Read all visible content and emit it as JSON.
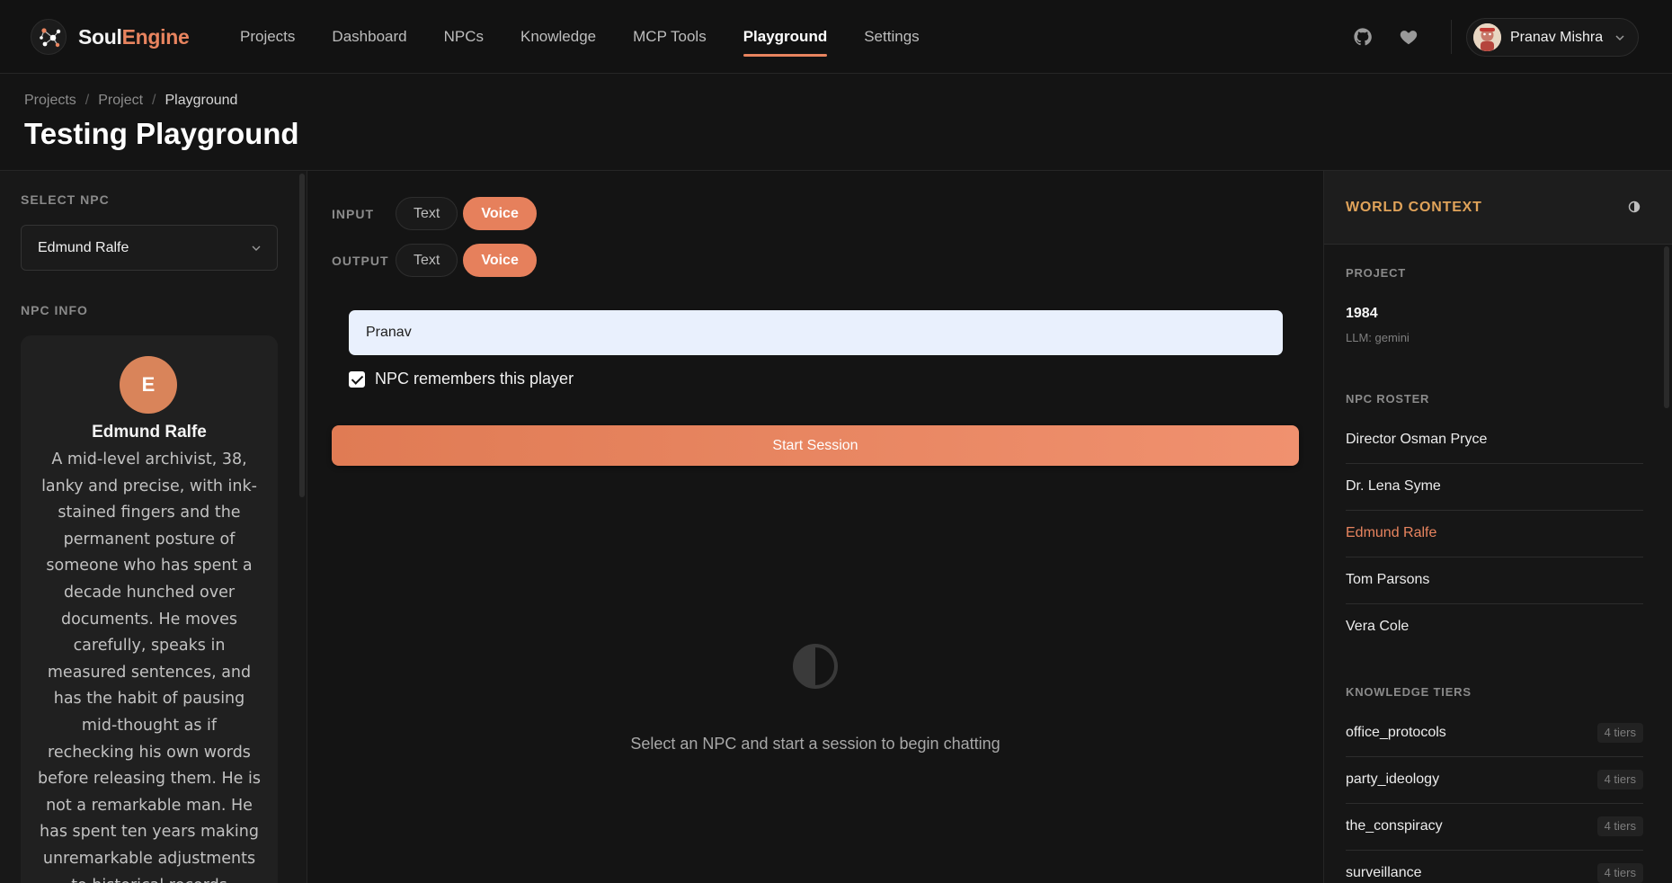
{
  "brand": {
    "name_part1": "Soul",
    "name_part2": "Engine"
  },
  "nav": {
    "items": [
      {
        "label": "Projects"
      },
      {
        "label": "Dashboard"
      },
      {
        "label": "NPCs"
      },
      {
        "label": "Knowledge"
      },
      {
        "label": "MCP Tools"
      },
      {
        "label": "Playground",
        "active": true
      },
      {
        "label": "Settings"
      }
    ],
    "github_icon": "github-icon",
    "heart_icon": "heart-icon"
  },
  "user": {
    "name": "Pranav Mishra"
  },
  "breadcrumb": {
    "items": [
      "Projects",
      "Project",
      "Playground"
    ]
  },
  "page": {
    "title": "Testing Playground"
  },
  "left": {
    "select_label": "SELECT NPC",
    "selected_npc": "Edmund Ralfe",
    "info_label": "NPC INFO",
    "npc": {
      "initial": "E",
      "name": "Edmund Ralfe",
      "description": "A mid-level archivist, 38, lanky and precise, with ink-stained fingers and the permanent posture of someone who has spent a decade hunched over documents. He moves carefully, speaks in measured sentences, and has the habit of pausing mid-thought as if rechecking his own words before releasing them. He is not a remarkable man. He has spent ten years making unremarkable adjustments to historical records"
    }
  },
  "center": {
    "input_label": "INPUT",
    "output_label": "OUTPUT",
    "text_label": "Text",
    "voice_label": "Voice",
    "player_name": "Pranav",
    "remember_label": "NPC remembers this player",
    "remember_checked": true,
    "start_label": "Start Session",
    "empty_text": "Select an NPC and start a session to begin chatting"
  },
  "right": {
    "title": "WORLD CONTEXT",
    "project_label": "PROJECT",
    "project_name": "1984",
    "project_llm": "LLM: gemini",
    "roster_label": "NPC ROSTER",
    "roster": [
      {
        "name": "Director Osman Pryce"
      },
      {
        "name": "Dr. Lena Syme"
      },
      {
        "name": "Edmund Ralfe",
        "active": true
      },
      {
        "name": "Tom Parsons"
      },
      {
        "name": "Vera Cole"
      }
    ],
    "tiers_label": "KNOWLEDGE TIERS",
    "tiers": [
      {
        "name": "office_protocols",
        "count": "4 tiers"
      },
      {
        "name": "party_ideology",
        "count": "4 tiers"
      },
      {
        "name": "the_conspiracy",
        "count": "4 tiers"
      },
      {
        "name": "surveillance",
        "count": "4 tiers"
      }
    ]
  },
  "colors": {
    "accent": "#e8845f",
    "world_context": "#e0a35a",
    "bg": "#141414"
  }
}
